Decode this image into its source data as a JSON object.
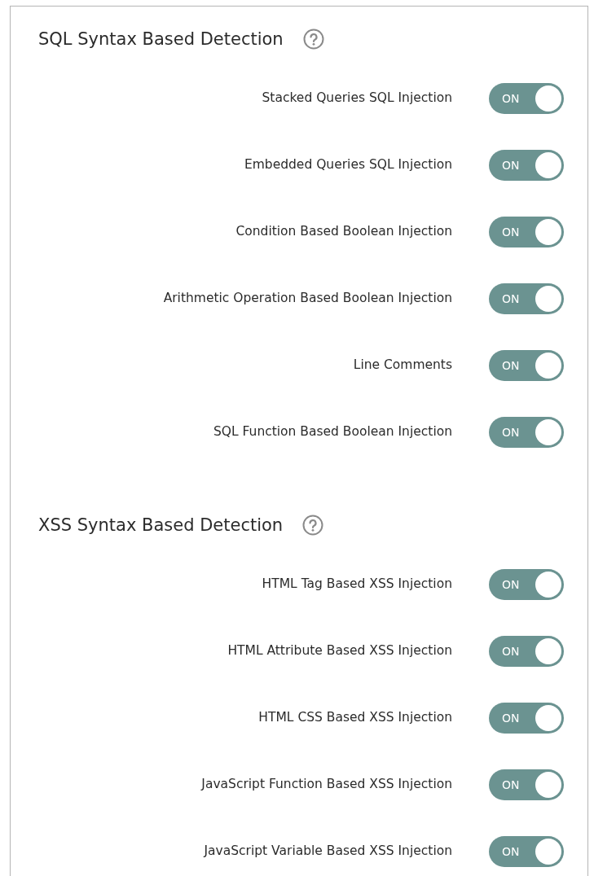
{
  "sections": [
    {
      "title": "SQL Syntax Based Detection",
      "options": [
        {
          "label": "Stacked Queries SQL Injection",
          "on": true,
          "state_text": "ON"
        },
        {
          "label": "Embedded Queries SQL Injection",
          "on": true,
          "state_text": "ON"
        },
        {
          "label": "Condition Based Boolean Injection",
          "on": true,
          "state_text": "ON"
        },
        {
          "label": "Arithmetic Operation Based Boolean Injection",
          "on": true,
          "state_text": "ON"
        },
        {
          "label": "Line Comments",
          "on": true,
          "state_text": "ON"
        },
        {
          "label": "SQL Function Based Boolean Injection",
          "on": true,
          "state_text": "ON"
        }
      ]
    },
    {
      "title": "XSS Syntax Based Detection",
      "options": [
        {
          "label": "HTML Tag Based XSS Injection",
          "on": true,
          "state_text": "ON"
        },
        {
          "label": "HTML Attribute Based XSS Injection",
          "on": true,
          "state_text": "ON"
        },
        {
          "label": "HTML CSS Based XSS Injection",
          "on": true,
          "state_text": "ON"
        },
        {
          "label": "JavaScript Function Based XSS Injection",
          "on": true,
          "state_text": "ON"
        },
        {
          "label": "JavaScript Variable Based XSS Injection",
          "on": true,
          "state_text": "ON"
        }
      ]
    }
  ]
}
